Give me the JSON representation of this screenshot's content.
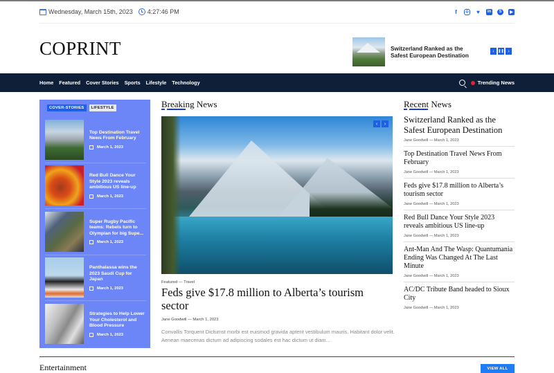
{
  "topbar": {
    "date": "Wednesday, March 15th, 2023",
    "time": "4:27:46 PM",
    "icons": {
      "date": "calendar-icon",
      "time": "clock-icon"
    },
    "socials": [
      {
        "name": "facebook-icon",
        "glyph": "f"
      },
      {
        "name": "instagram-icon",
        "glyph": "◎"
      },
      {
        "name": "twitter-icon",
        "glyph": "♥"
      },
      {
        "name": "linkedin-icon",
        "glyph": "in"
      },
      {
        "name": "skype-icon",
        "glyph": "S"
      },
      {
        "name": "youtube-icon",
        "glyph": "▶"
      }
    ]
  },
  "header": {
    "logo": "COPRINT",
    "ticker": {
      "title": "Switzerland Ranked as the Safest European Destination",
      "controls": {
        "prev": "‹",
        "pause": "❚❚",
        "next": "›"
      }
    }
  },
  "nav": {
    "items": [
      "Home",
      "Featured",
      "Cover Stories",
      "Sports",
      "Lifestyle",
      "Technology"
    ],
    "trending": "Trending News"
  },
  "sidebar": {
    "tabs": [
      "COVER-STORIES",
      "LIFESTYLE"
    ],
    "items": [
      {
        "title": "Top Destination Travel News From February",
        "date": "March 1, 2023"
      },
      {
        "title": "Red Bull Dance Your Style 2023 reveals ambitious US line-up",
        "date": "March 1, 2023"
      },
      {
        "title": "Super Rugby Pacific teams: Rebels turn to Olympian for big Supe...",
        "date": "March 1, 2023"
      },
      {
        "title": "Panthalassa wins the 2023 Saudi Cup for Japan",
        "date": "March 1, 2023"
      },
      {
        "title": "Strategies to Help Lower Your Cholesterol and Blood Pressure",
        "date": "March 1, 2023"
      }
    ]
  },
  "breaking": {
    "section_title": "Breaking News",
    "controls": {
      "prev": "‹",
      "next": "›"
    },
    "categories": "Featured  —  Travel",
    "headline": "Feds give $17.8 million to Alberta’s tourism sector",
    "byline": "Jane Goodwill  —  March 1, 2023",
    "excerpt": "Convallis Torquent Dictumst morbi est euismod gravida aptent vestibulum mauris. Habitant dolor velit. Aenean maecenas dictum ad adipiscing sodales est hac dictum ut diam..."
  },
  "recent": {
    "section_title": "Recent News",
    "items": [
      {
        "title": "Switzerland Ranked as the Safest European Destination",
        "meta": "Jane Goodwill  —  March 1, 2023"
      },
      {
        "title": "Top Destination Travel News From February",
        "meta": "Jane Goodwill  —  March 1, 2023"
      },
      {
        "title": "Feds give $17.8 million to Alberta’s tourism sector",
        "meta": "Jane Goodwill  —  March 1, 2023"
      },
      {
        "title": "Red Bull Dance Your Style 2023 reveals ambitious US line-up",
        "meta": "Jane Goodwill  —  March 1, 2023"
      },
      {
        "title": "Ant-Man And The Wasp: Quantumania Ending Was Changed At The Last Minute",
        "meta": "Jane Goodwill  —  March 1, 2023"
      },
      {
        "title": "AC/DC Tribute Band headed to Sioux City",
        "meta": "Jane Goodwill  —  March 1, 2023"
      }
    ]
  },
  "entertainment": {
    "section_title": "Entertainment",
    "view_all": "VIEW ALL"
  },
  "colors": {
    "accent": "#1f5ee6",
    "nav_bg": "#0f1f38",
    "sidebar_bg": "#6d86f7",
    "trending_dot": "#e0233a",
    "view_all_bg": "#1f7cf2"
  }
}
